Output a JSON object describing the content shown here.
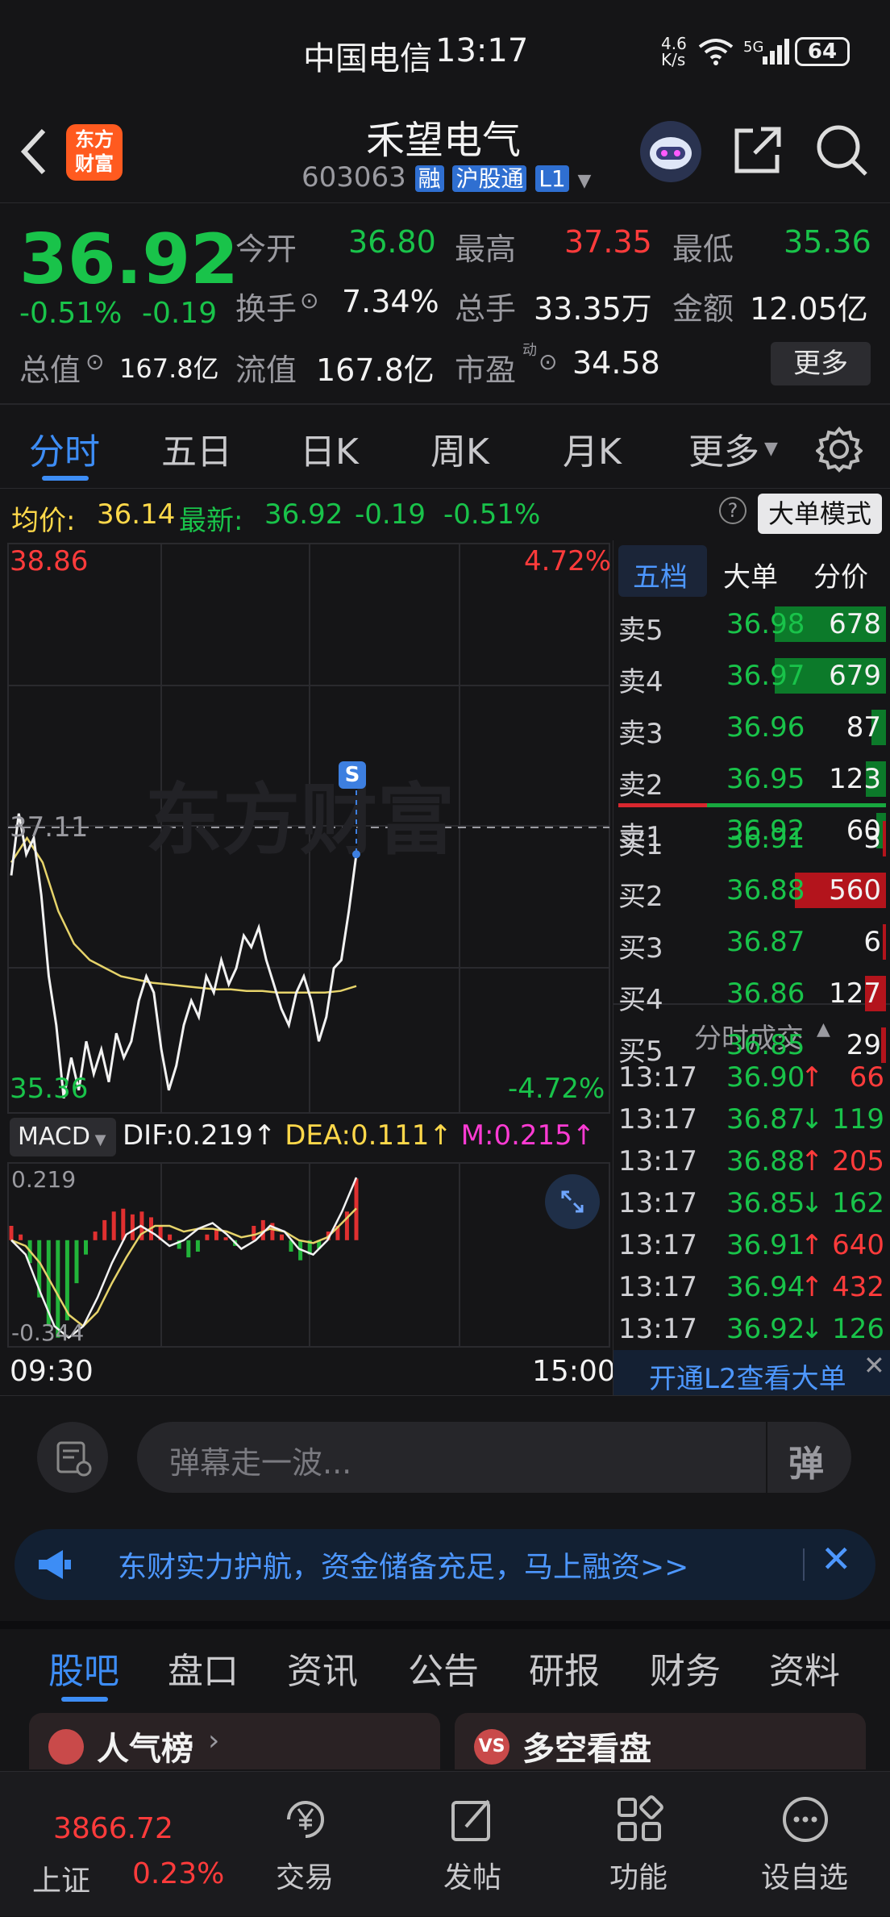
{
  "status_bar": {
    "carrier": "中国电信",
    "time": "13:17",
    "net_speed_top": "4.6",
    "net_speed_bottom": "K/s",
    "network": "5G",
    "battery": "64"
  },
  "header": {
    "stock_name": "禾望电气",
    "stock_code": "603063",
    "badge_margin": "融",
    "badge_connect": "沪股通",
    "badge_level": "L1",
    "logo_text_top": "东方",
    "logo_text_bottom": "财富"
  },
  "quote": {
    "price": "36.92",
    "change_pct": "-0.51%",
    "change_amt": "-0.19",
    "open_label": "今开",
    "open": "36.80",
    "high_label": "最高",
    "high": "37.35",
    "low_label": "最低",
    "low": "35.36",
    "turnover_label": "换手",
    "turnover": "7.34%",
    "volume_label": "总手",
    "volume": "33.35万",
    "amount_label": "金额",
    "amount": "12.05亿",
    "mktcap_label": "总值",
    "mktcap": "167.8亿",
    "float_label": "流值",
    "float": "167.8亿",
    "pe_label": "市盈",
    "pe_sup": "动",
    "pe": "34.58",
    "more_button": "更多"
  },
  "chart_tabs": [
    "分时",
    "五日",
    "日K",
    "周K",
    "月K",
    "更多"
  ],
  "avg_bar": {
    "avg_label": "均价:",
    "avg": "36.14",
    "latest_label": "最新:",
    "latest": "36.92",
    "chg": "-0.19",
    "chg_pct": "-0.51%",
    "mode_button": "大单模式"
  },
  "chart_data": {
    "type": "line",
    "y_max": "38.86",
    "y_min": "35.36",
    "pct_max": "4.72%",
    "pct_min": "-4.72%",
    "ref_price": "37.11",
    "watermark": "东方财富",
    "signal_label": "S",
    "x_start": "09:30",
    "x_end": "15:00",
    "ylim": [
      35.36,
      38.86
    ],
    "price_series": [
      36.82,
      37.2,
      36.95,
      37.05,
      36.7,
      36.2,
      35.9,
      35.45,
      35.7,
      35.5,
      35.8,
      35.6,
      35.75,
      35.55,
      35.85,
      35.7,
      35.8,
      36.05,
      36.2,
      36.1,
      35.75,
      35.5,
      35.65,
      35.9,
      36.05,
      35.95,
      36.2,
      36.1,
      36.3,
      36.15,
      36.25,
      36.45,
      36.38,
      36.5,
      36.3,
      36.15,
      36.0,
      35.9,
      36.1,
      36.2,
      36.05,
      35.8,
      35.95,
      36.25,
      36.3,
      36.6,
      36.95
    ],
    "avg_series": [
      36.9,
      37.05,
      36.9,
      36.6,
      36.4,
      36.3,
      36.25,
      36.2,
      36.18,
      36.16,
      36.15,
      36.14,
      36.13,
      36.12,
      36.12,
      36.11,
      36.11,
      36.1,
      36.1,
      36.1,
      36.1,
      36.11,
      36.14
    ],
    "macd": {
      "label": "MACD",
      "dif_label": "DIF:",
      "dif": "0.219",
      "dea_label": "DEA:",
      "dea": "0.111",
      "m_label": "M:",
      "m": "0.215",
      "axis_top": "0.219",
      "axis_bottom": "-0.344",
      "hist": [
        0.05,
        0.02,
        -0.08,
        -0.2,
        -0.3,
        -0.34,
        -0.28,
        -0.15,
        -0.05,
        0.03,
        0.07,
        0.1,
        0.11,
        0.09,
        0.1,
        0.08,
        0.05,
        0.02,
        -0.03,
        -0.06,
        -0.04,
        0.02,
        0.04,
        0.01,
        -0.02,
        0.0,
        0.05,
        0.07,
        0.06,
        0.02,
        -0.04,
        -0.07,
        -0.05,
        -0.03,
        0.03,
        0.05,
        0.1,
        0.215
      ],
      "dif_series": [
        0.0,
        -0.05,
        -0.18,
        -0.3,
        -0.34,
        -0.3,
        -0.2,
        -0.08,
        0.02,
        0.05,
        0.02,
        -0.02,
        0.0,
        0.04,
        0.06,
        0.02,
        -0.03,
        0.0,
        0.05,
        0.03,
        -0.03,
        -0.05,
        0.0,
        0.1,
        0.219
      ],
      "dea_series": [
        0.0,
        -0.02,
        -0.08,
        -0.17,
        -0.26,
        -0.3,
        -0.25,
        -0.15,
        -0.06,
        0.02,
        0.05,
        0.05,
        0.03,
        0.04,
        0.04,
        0.03,
        0.01,
        0.02,
        0.04,
        0.03,
        0.0,
        -0.01,
        0.01,
        0.06,
        0.111
      ]
    }
  },
  "order_book": {
    "tabs": [
      "五档",
      "大单",
      "分价"
    ],
    "asks": [
      {
        "label": "卖5",
        "price": "36.98",
        "vol": "678",
        "bar": 1.0
      },
      {
        "label": "卖4",
        "price": "36.97",
        "vol": "679",
        "bar": 1.0
      },
      {
        "label": "卖3",
        "price": "36.96",
        "vol": "87",
        "bar": 0.13
      },
      {
        "label": "卖2",
        "price": "36.95",
        "vol": "123",
        "bar": 0.18
      },
      {
        "label": "卖1",
        "price": "36.92",
        "vol": "60",
        "bar": 0.09
      }
    ],
    "bids": [
      {
        "label": "买1",
        "price": "36.91",
        "vol": "3",
        "bar": 0.01
      },
      {
        "label": "买2",
        "price": "36.88",
        "vol": "560",
        "bar": 0.82
      },
      {
        "label": "买3",
        "price": "36.87",
        "vol": "6",
        "bar": 0.01
      },
      {
        "label": "买4",
        "price": "36.86",
        "vol": "127",
        "bar": 0.19
      },
      {
        "label": "买5",
        "price": "36.85",
        "vol": "29",
        "bar": 0.04
      }
    ],
    "trades_title": "分时成交",
    "trades": [
      {
        "time": "13:17",
        "price": "36.90",
        "dir": "↑",
        "vol": "66",
        "up": true
      },
      {
        "time": "13:17",
        "price": "36.87",
        "dir": "↓",
        "vol": "119",
        "up": false
      },
      {
        "time": "13:17",
        "price": "36.88",
        "dir": "↑",
        "vol": "205",
        "up": true
      },
      {
        "time": "13:17",
        "price": "36.85",
        "dir": "↓",
        "vol": "162",
        "up": false
      },
      {
        "time": "13:17",
        "price": "36.91",
        "dir": "↑",
        "vol": "640",
        "up": true
      },
      {
        "time": "13:17",
        "price": "36.94",
        "dir": "↑",
        "vol": "432",
        "up": true
      },
      {
        "time": "13:17",
        "price": "36.92",
        "dir": "↓",
        "vol": "126",
        "up": false
      }
    ],
    "l2_promo": "开通L2查看大单"
  },
  "danmu": {
    "placeholder": "弹幕走一波...",
    "send_label": "弹"
  },
  "banner": {
    "text": "东财实力护航，资金储备充足，马上融资>>"
  },
  "sub_tabs": [
    "股吧",
    "盘口",
    "资讯",
    "公告",
    "研报",
    "财务",
    "资料"
  ],
  "cards": {
    "left_title": "人气榜",
    "right_title": "多空看盘"
  },
  "bottom_nav": {
    "index_value": "3866.72",
    "index_name": "上证",
    "index_change": "0.23%",
    "items": [
      "交易",
      "发帖",
      "功能",
      "设自选"
    ]
  }
}
